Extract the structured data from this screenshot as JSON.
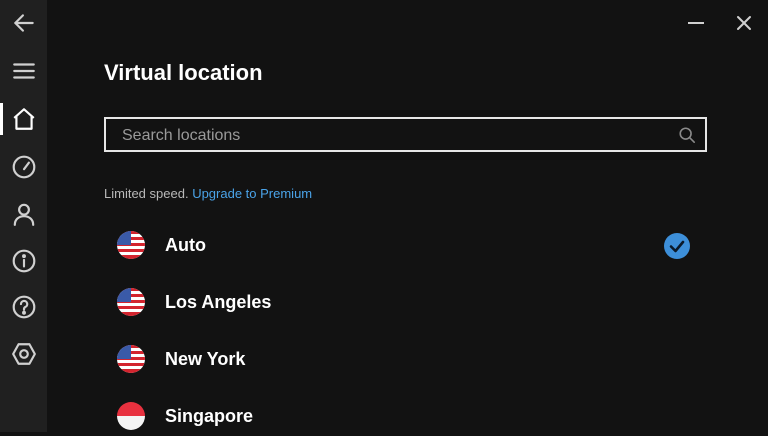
{
  "header": {
    "title": "Virtual location"
  },
  "search": {
    "placeholder": "Search locations"
  },
  "notice": {
    "text": "Limited speed.",
    "link": "Upgrade to Premium"
  },
  "locations": [
    {
      "name": "Auto",
      "flag": "us-flag-icon",
      "selected": true
    },
    {
      "name": "Los Angeles",
      "flag": "us-flag-icon",
      "selected": false
    },
    {
      "name": "New York",
      "flag": "us-flag-icon",
      "selected": false
    },
    {
      "name": "Singapore",
      "flag": "sg-flag-icon",
      "selected": false
    }
  ],
  "sidebar": {
    "items": [
      "back-icon",
      "menu-icon",
      "home-icon",
      "speedometer-icon",
      "account-icon",
      "info-icon",
      "help-icon",
      "settings-icon"
    ],
    "active": "home-icon"
  },
  "colors": {
    "accent": "#4aa3e8",
    "check": "#3d8fd9",
    "background": "#121212",
    "sidebar": "#202020"
  }
}
